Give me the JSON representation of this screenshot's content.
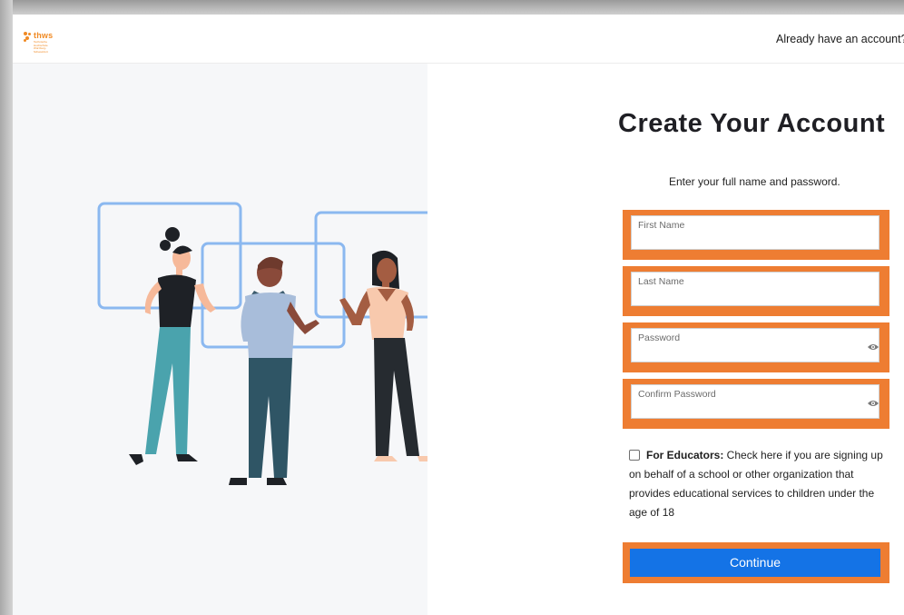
{
  "header": {
    "logo_name": "thws",
    "logo_subtitle": "Technische Hochschule Würzburg-Schweinfurt",
    "signin_text": "Already have an account?"
  },
  "main": {
    "title": "Create Your Account",
    "subtitle": "Enter your full name and password.",
    "fields": [
      {
        "label": "First Name"
      },
      {
        "label": "Last Name"
      },
      {
        "label": "Password"
      },
      {
        "label": "Confirm Password"
      }
    ],
    "educator_bold": "For Educators:",
    "educator_text": " Check here if you are signing up on behalf of a school or other organization that provides educational services to children under the age of 18",
    "continue_label": "Continue"
  },
  "colors": {
    "highlight": "#ee7d32",
    "primary": "#1473e6",
    "brand": "#f08a24",
    "frame": "#8bb8f0"
  },
  "illustration": {
    "icon": "people-collaborating-illustration"
  }
}
